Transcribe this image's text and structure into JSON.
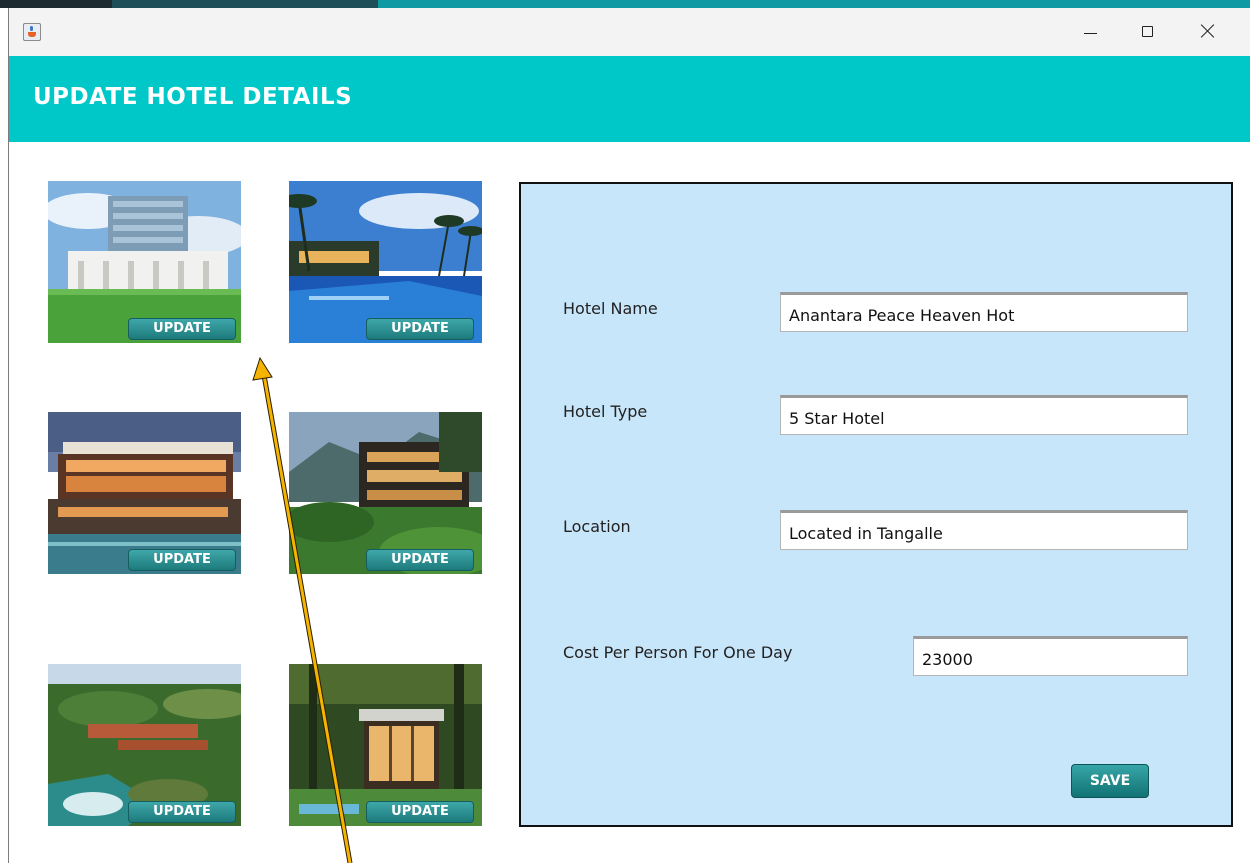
{
  "window": {
    "icon": "java-cup-icon",
    "controls": [
      "minimize-icon",
      "maximize-icon",
      "close-icon"
    ]
  },
  "header": {
    "title": "UPDATE HOTEL DETAILS",
    "bg_color": "#00c8c8"
  },
  "hotels": [
    {
      "image": "hotel-building-with-lawn",
      "button_label": "UPDATE"
    },
    {
      "image": "hotel-pool-with-palm-trees",
      "button_label": "UPDATE"
    },
    {
      "image": "hotel-restaurant-at-dusk-with-pool",
      "button_label": "UPDATE"
    },
    {
      "image": "hillside-hotel-with-garden",
      "button_label": "UPDATE"
    },
    {
      "image": "aerial-coastal-resort",
      "button_label": "UPDATE"
    },
    {
      "image": "forest-villa-with-pool",
      "button_label": "UPDATE"
    }
  ],
  "form": {
    "bg_color": "#c8e6fa",
    "hotel_name": {
      "label": "Hotel Name",
      "value": "Anantara Peace Heaven Hot"
    },
    "hotel_type": {
      "label": "Hotel Type",
      "value": "5 Star Hotel"
    },
    "location": {
      "label": "Location",
      "value": "Located in Tangalle"
    },
    "cost": {
      "label": "Cost Per Person For One Day",
      "value": "23000"
    },
    "save_label": "SAVE"
  },
  "annotation": {
    "type": "arrow",
    "color": "#f5b400"
  }
}
